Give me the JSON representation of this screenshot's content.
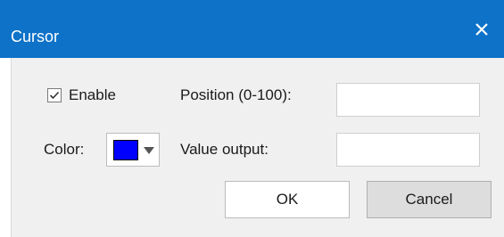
{
  "window": {
    "title": "Cursor",
    "close_icon": "close-icon",
    "titlebar_color": "#0d72c8"
  },
  "form": {
    "enable_label": "Enable",
    "enable_checked": true,
    "color_label": "Color:",
    "color_value": "#0000ff",
    "position_label": "Position (0-100):",
    "position_value": "",
    "value_output_label": "Value output:",
    "value_output_value": ""
  },
  "buttons": {
    "ok_label": "OK",
    "cancel_label": "Cancel"
  }
}
